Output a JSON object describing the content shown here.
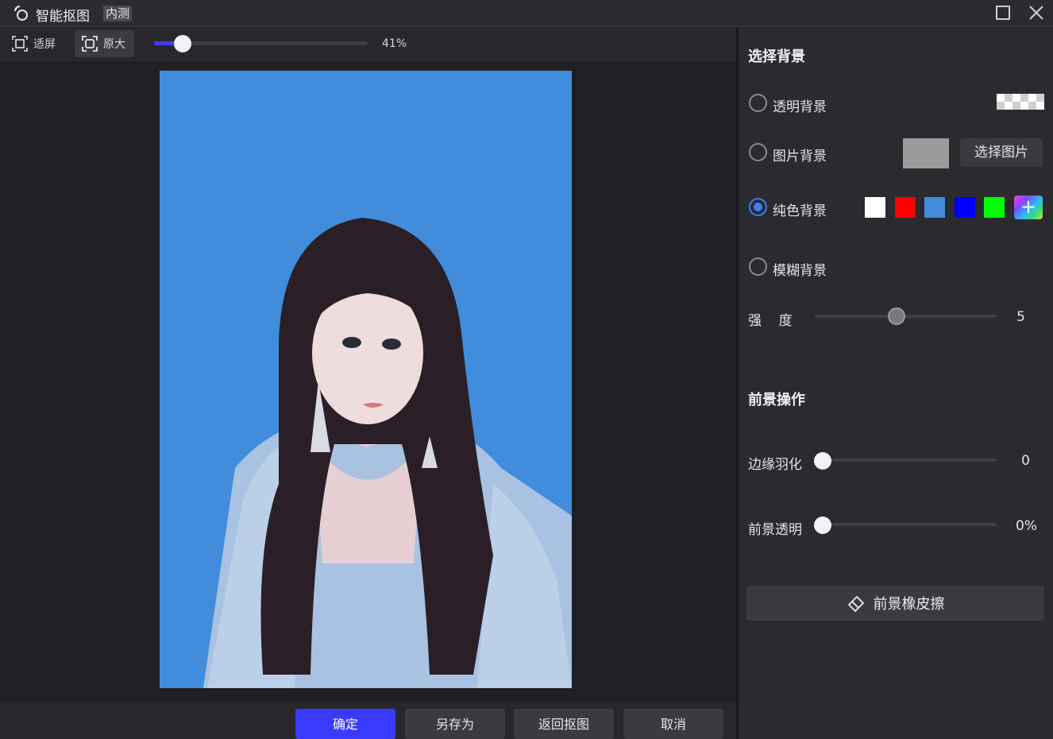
{
  "window": {
    "title": "智能抠图",
    "badge": "内测"
  },
  "toolbar": {
    "fit_label": "适屏",
    "original_label": "原大",
    "zoom_value": "41%",
    "zoom_fraction": 0.13
  },
  "panel": {
    "background_title": "选择背景",
    "options": {
      "transparent": "透明背景",
      "image": "图片背景",
      "solid": "纯色背景",
      "blur": "模糊背景"
    },
    "selected_option": "solid",
    "choose_image_label": "选择图片",
    "swatches": [
      "#ffffff",
      "#ff0000",
      "#418ddc",
      "#0000ff",
      "#00ff00"
    ],
    "add_swatch_label": "+",
    "strength_label": "强    度",
    "strength_value": "5",
    "foreground_title": "前景操作",
    "feather_label": "边缘羽化",
    "feather_value": "0",
    "fg_transparency_label": "前景透明",
    "fg_transparency_value": "0%",
    "eraser_label": "前景橡皮擦"
  },
  "footer": {
    "confirm": "确定",
    "save_as": "另存为",
    "back": "返回抠图",
    "cancel": "取消"
  }
}
